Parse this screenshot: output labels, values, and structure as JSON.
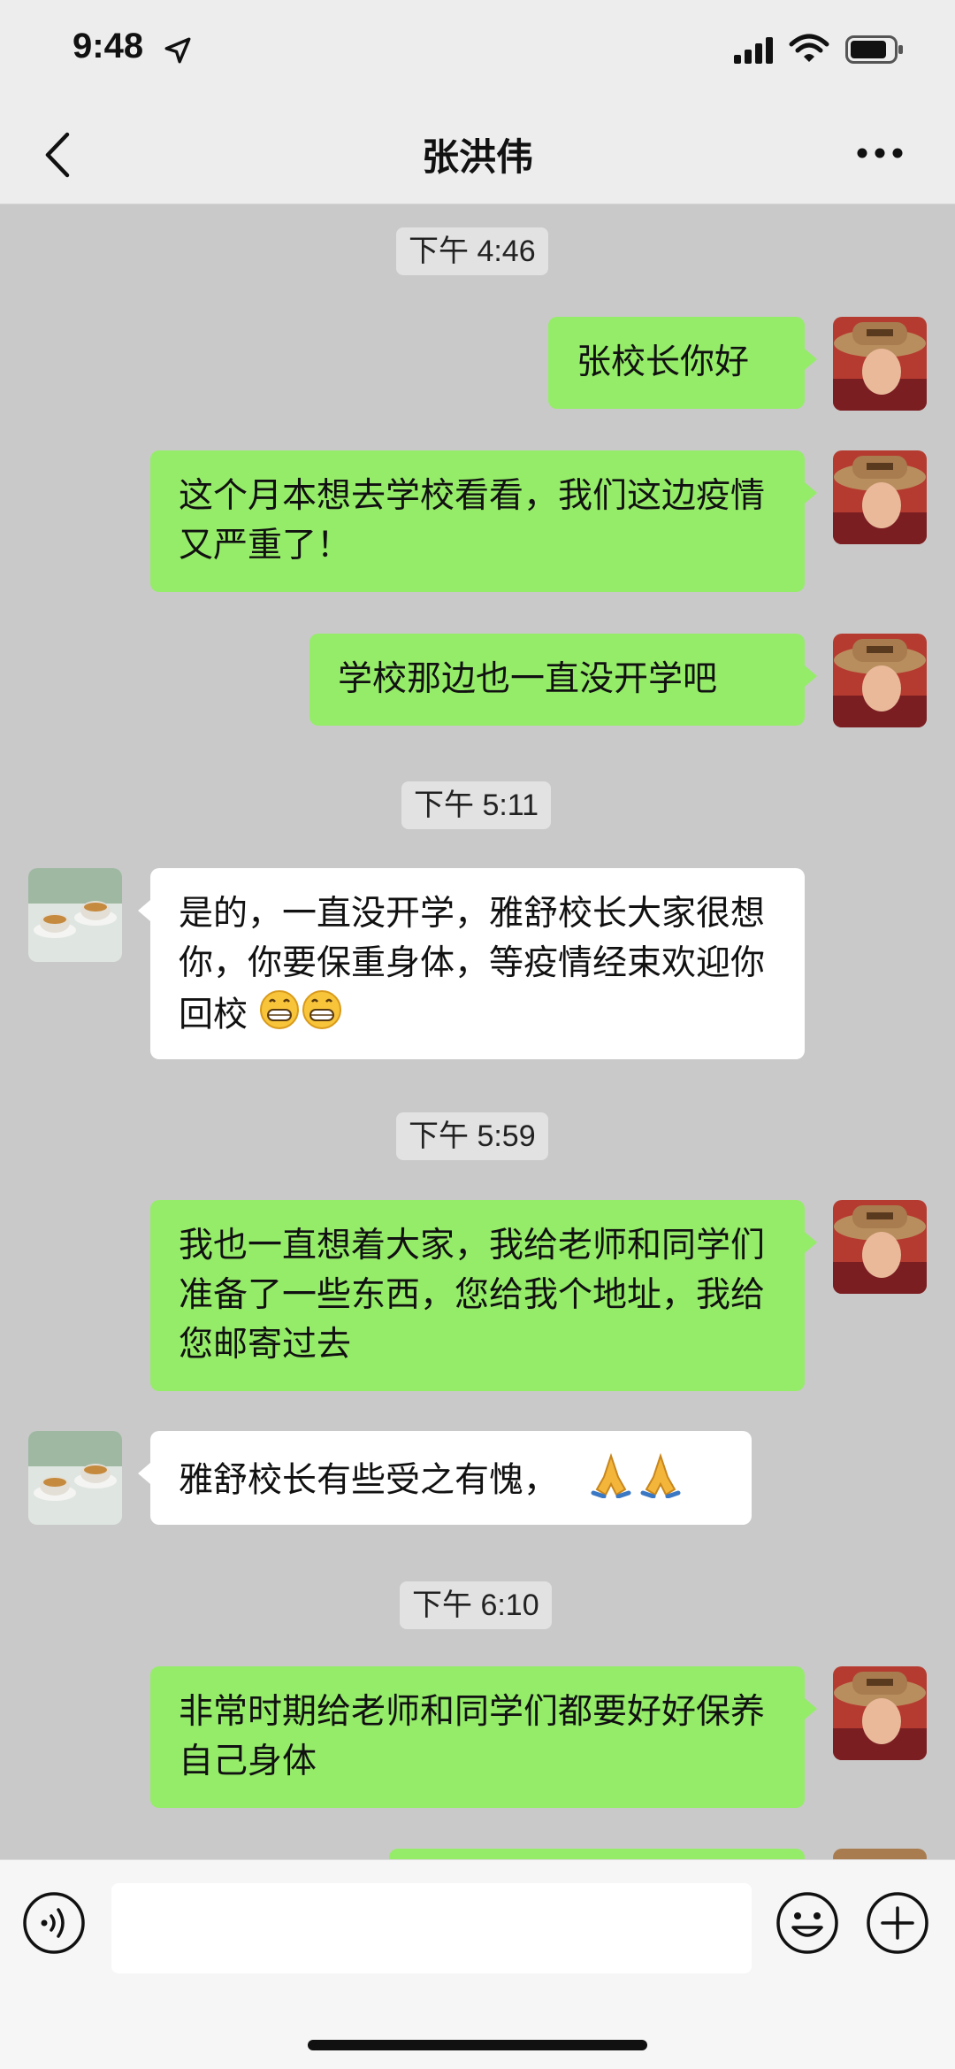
{
  "status_bar": {
    "time": "9:48",
    "location_icon": "location-arrow-icon",
    "signal_icon": "cellular-signal-icon",
    "wifi_icon": "wifi-icon",
    "battery_icon": "battery-icon"
  },
  "nav": {
    "back_icon": "chevron-left-icon",
    "title": "张洪伟",
    "more_icon": "more-dots-icon"
  },
  "messages": [
    {
      "type": "timestamp",
      "text": "下午 4:46"
    },
    {
      "type": "sent",
      "text": "张校长你好"
    },
    {
      "type": "sent",
      "text": "这个月本想去学校看看，我们这边疫情又严重了！"
    },
    {
      "type": "sent",
      "text": "学校那边也一直没开学吧"
    },
    {
      "type": "timestamp",
      "text": "下午 5:11"
    },
    {
      "type": "received",
      "text": "是的，一直没开学，雅舒校长大家很想你，你要保重身体，等疫情经束欢迎你回校",
      "emoji": "grinning-face-emoji ×2"
    },
    {
      "type": "timestamp",
      "text": "下午 5:59"
    },
    {
      "type": "sent",
      "text": "我也一直想着大家，我给老师和同学们准备了一些东西，您给我个地址，我给您邮寄过去"
    },
    {
      "type": "received",
      "text": "雅舒校长有些受之有愧，",
      "emoji": "folded-hands-emoji ×2"
    },
    {
      "type": "timestamp",
      "text": "下午 6:10"
    },
    {
      "type": "sent",
      "text": "非常时期给老师和同学们都要好好保养自己身体"
    }
  ],
  "input_bar": {
    "voice_icon": "voice-icon",
    "input_value": "",
    "emoji_icon": "smiley-icon",
    "add_icon": "plus-circle-icon"
  },
  "colors": {
    "sent_bubble": "#95ec69",
    "received_bubble": "#ffffff",
    "chat_background": "#c9c9c9",
    "header_background": "#ededed"
  }
}
